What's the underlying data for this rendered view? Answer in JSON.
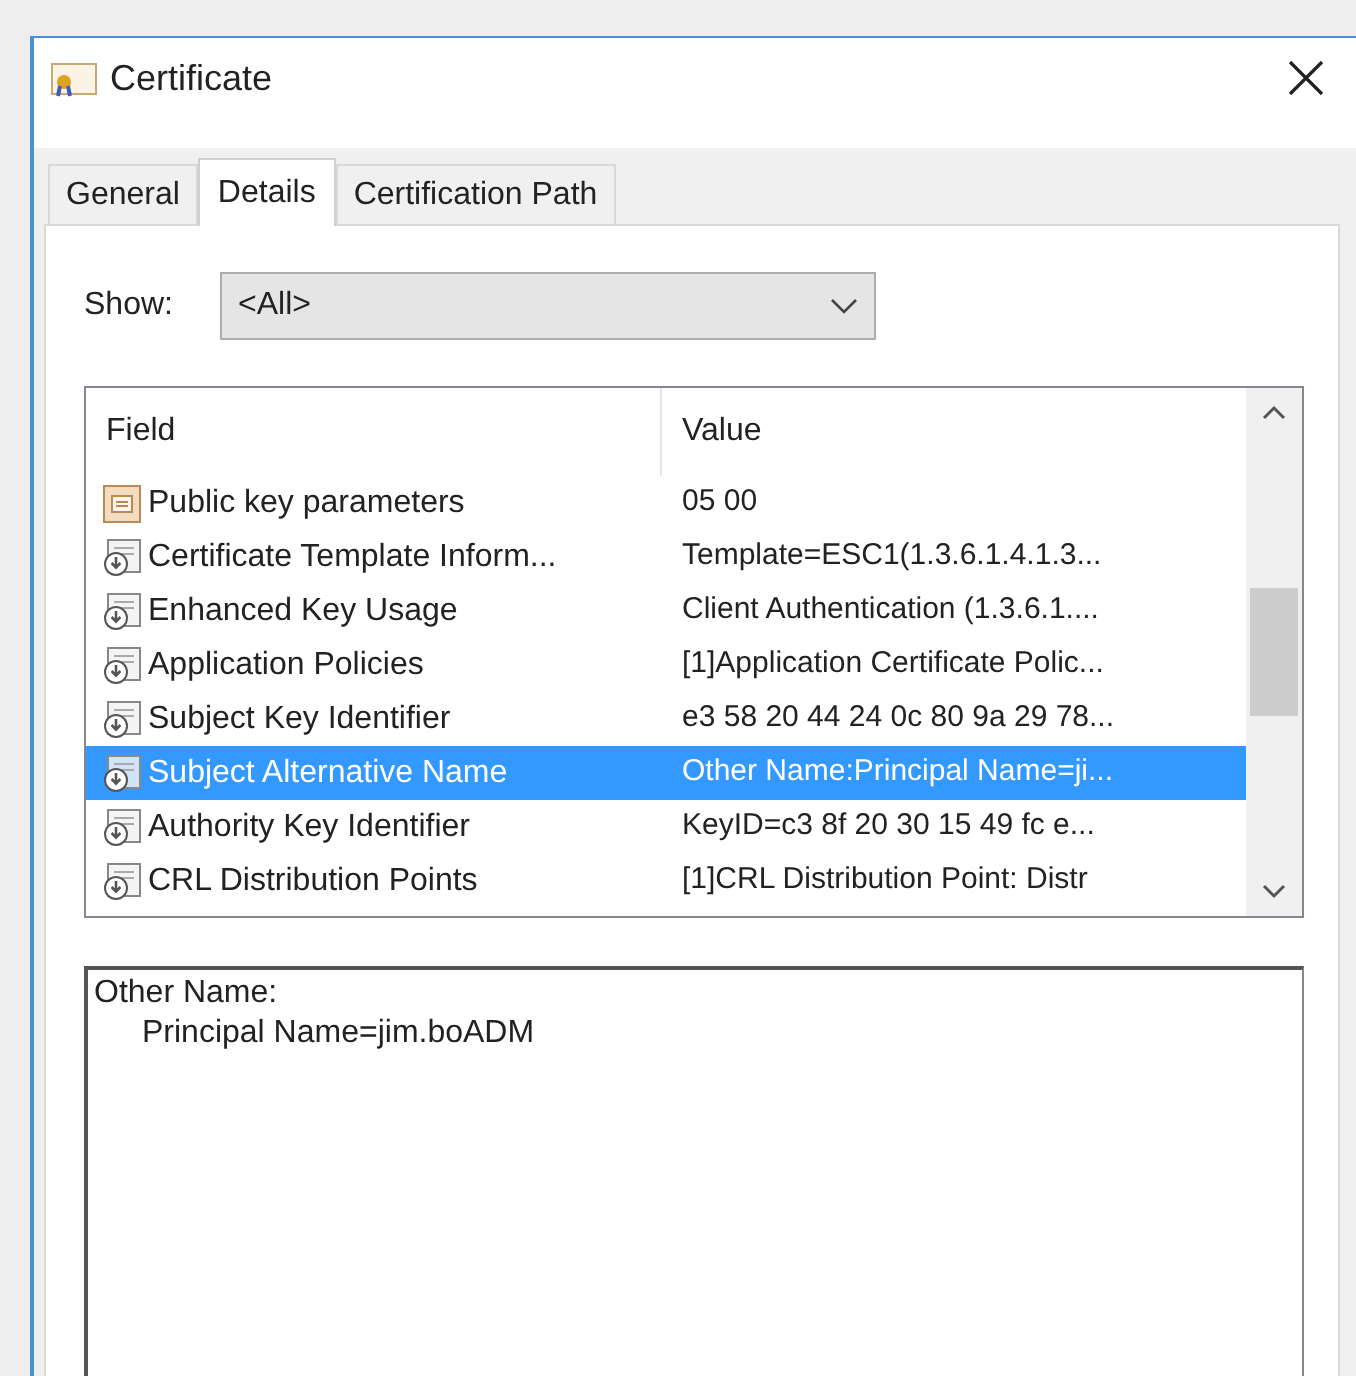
{
  "window": {
    "title": "Certificate"
  },
  "tabs": [
    {
      "label": "General",
      "selected": false
    },
    {
      "label": "Details",
      "selected": true
    },
    {
      "label": "Certification Path",
      "selected": false
    }
  ],
  "show": {
    "label": "Show:",
    "value": "<All>"
  },
  "table": {
    "columns": [
      "Field",
      "Value"
    ],
    "rows": [
      {
        "kind": "property",
        "field": "Public key parameters",
        "value": "05 00",
        "selected": false
      },
      {
        "kind": "extension",
        "field": "Certificate Template Inform...",
        "value": "Template=ESC1(1.3.6.1.4.1.3...",
        "selected": false
      },
      {
        "kind": "extension",
        "field": "Enhanced Key Usage",
        "value": "Client Authentication (1.3.6.1....",
        "selected": false
      },
      {
        "kind": "extension",
        "field": "Application Policies",
        "value": "[1]Application Certificate Polic...",
        "selected": false
      },
      {
        "kind": "extension",
        "field": "Subject Key Identifier",
        "value": "e3 58 20 44 24 0c 80 9a 29 78...",
        "selected": false
      },
      {
        "kind": "extension",
        "field": "Subject Alternative Name",
        "value": "Other Name:Principal Name=ji...",
        "selected": true
      },
      {
        "kind": "extension",
        "field": "Authority Key Identifier",
        "value": "KeyID=c3 8f 20 30 15 49 fc e...",
        "selected": false
      },
      {
        "kind": "extension",
        "field": "CRL Distribution Points",
        "value": "[1]CRL Distribution Point: Distr",
        "selected": false
      }
    ]
  },
  "detail": [
    "Other Name:",
    "Principal Name=jim.boADM"
  ]
}
